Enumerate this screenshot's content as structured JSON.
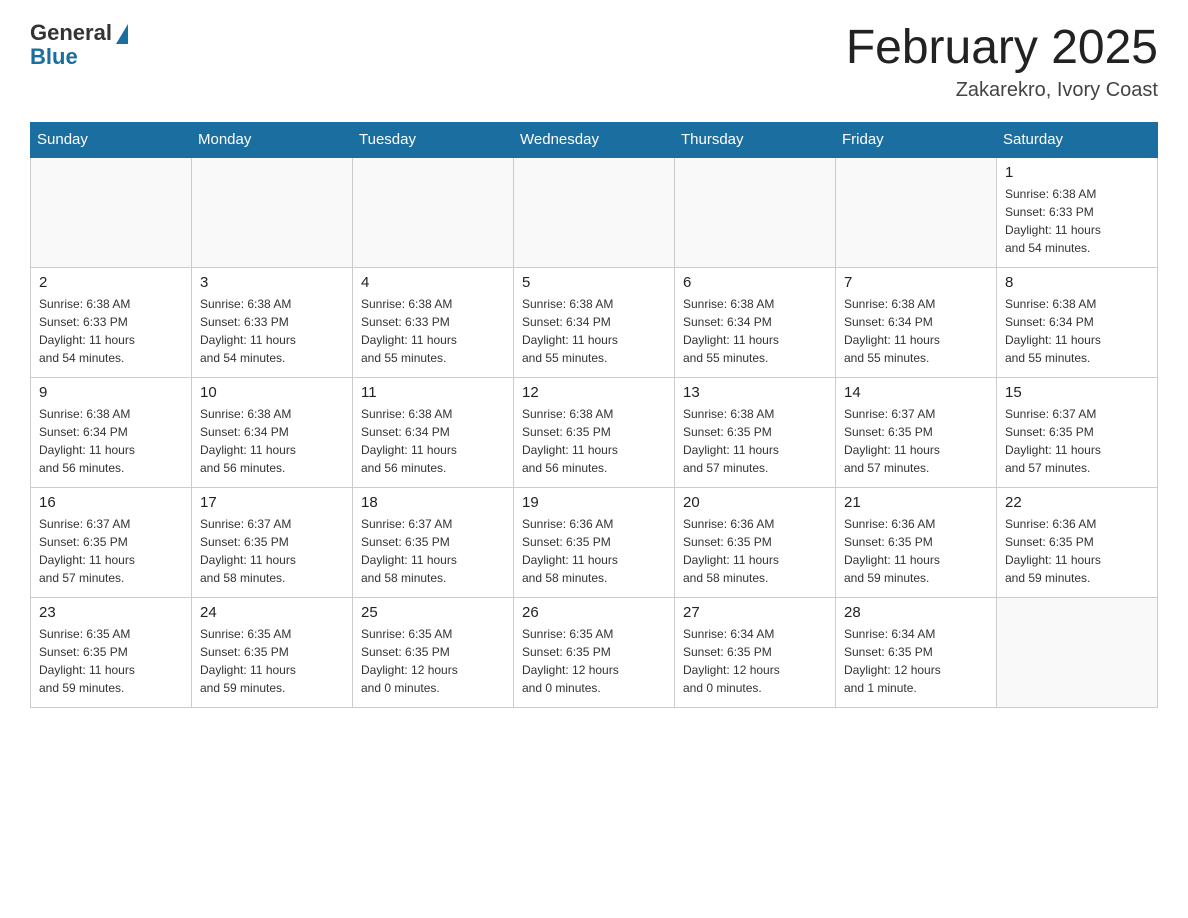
{
  "header": {
    "logo_general": "General",
    "logo_blue": "Blue",
    "month_title": "February 2025",
    "location": "Zakarekro, Ivory Coast"
  },
  "days_of_week": [
    "Sunday",
    "Monday",
    "Tuesday",
    "Wednesday",
    "Thursday",
    "Friday",
    "Saturday"
  ],
  "weeks": [
    [
      {
        "day": "",
        "info": ""
      },
      {
        "day": "",
        "info": ""
      },
      {
        "day": "",
        "info": ""
      },
      {
        "day": "",
        "info": ""
      },
      {
        "day": "",
        "info": ""
      },
      {
        "day": "",
        "info": ""
      },
      {
        "day": "1",
        "info": "Sunrise: 6:38 AM\nSunset: 6:33 PM\nDaylight: 11 hours\nand 54 minutes."
      }
    ],
    [
      {
        "day": "2",
        "info": "Sunrise: 6:38 AM\nSunset: 6:33 PM\nDaylight: 11 hours\nand 54 minutes."
      },
      {
        "day": "3",
        "info": "Sunrise: 6:38 AM\nSunset: 6:33 PM\nDaylight: 11 hours\nand 54 minutes."
      },
      {
        "day": "4",
        "info": "Sunrise: 6:38 AM\nSunset: 6:33 PM\nDaylight: 11 hours\nand 55 minutes."
      },
      {
        "day": "5",
        "info": "Sunrise: 6:38 AM\nSunset: 6:34 PM\nDaylight: 11 hours\nand 55 minutes."
      },
      {
        "day": "6",
        "info": "Sunrise: 6:38 AM\nSunset: 6:34 PM\nDaylight: 11 hours\nand 55 minutes."
      },
      {
        "day": "7",
        "info": "Sunrise: 6:38 AM\nSunset: 6:34 PM\nDaylight: 11 hours\nand 55 minutes."
      },
      {
        "day": "8",
        "info": "Sunrise: 6:38 AM\nSunset: 6:34 PM\nDaylight: 11 hours\nand 55 minutes."
      }
    ],
    [
      {
        "day": "9",
        "info": "Sunrise: 6:38 AM\nSunset: 6:34 PM\nDaylight: 11 hours\nand 56 minutes."
      },
      {
        "day": "10",
        "info": "Sunrise: 6:38 AM\nSunset: 6:34 PM\nDaylight: 11 hours\nand 56 minutes."
      },
      {
        "day": "11",
        "info": "Sunrise: 6:38 AM\nSunset: 6:34 PM\nDaylight: 11 hours\nand 56 minutes."
      },
      {
        "day": "12",
        "info": "Sunrise: 6:38 AM\nSunset: 6:35 PM\nDaylight: 11 hours\nand 56 minutes."
      },
      {
        "day": "13",
        "info": "Sunrise: 6:38 AM\nSunset: 6:35 PM\nDaylight: 11 hours\nand 57 minutes."
      },
      {
        "day": "14",
        "info": "Sunrise: 6:37 AM\nSunset: 6:35 PM\nDaylight: 11 hours\nand 57 minutes."
      },
      {
        "day": "15",
        "info": "Sunrise: 6:37 AM\nSunset: 6:35 PM\nDaylight: 11 hours\nand 57 minutes."
      }
    ],
    [
      {
        "day": "16",
        "info": "Sunrise: 6:37 AM\nSunset: 6:35 PM\nDaylight: 11 hours\nand 57 minutes."
      },
      {
        "day": "17",
        "info": "Sunrise: 6:37 AM\nSunset: 6:35 PM\nDaylight: 11 hours\nand 58 minutes."
      },
      {
        "day": "18",
        "info": "Sunrise: 6:37 AM\nSunset: 6:35 PM\nDaylight: 11 hours\nand 58 minutes."
      },
      {
        "day": "19",
        "info": "Sunrise: 6:36 AM\nSunset: 6:35 PM\nDaylight: 11 hours\nand 58 minutes."
      },
      {
        "day": "20",
        "info": "Sunrise: 6:36 AM\nSunset: 6:35 PM\nDaylight: 11 hours\nand 58 minutes."
      },
      {
        "day": "21",
        "info": "Sunrise: 6:36 AM\nSunset: 6:35 PM\nDaylight: 11 hours\nand 59 minutes."
      },
      {
        "day": "22",
        "info": "Sunrise: 6:36 AM\nSunset: 6:35 PM\nDaylight: 11 hours\nand 59 minutes."
      }
    ],
    [
      {
        "day": "23",
        "info": "Sunrise: 6:35 AM\nSunset: 6:35 PM\nDaylight: 11 hours\nand 59 minutes."
      },
      {
        "day": "24",
        "info": "Sunrise: 6:35 AM\nSunset: 6:35 PM\nDaylight: 11 hours\nand 59 minutes."
      },
      {
        "day": "25",
        "info": "Sunrise: 6:35 AM\nSunset: 6:35 PM\nDaylight: 12 hours\nand 0 minutes."
      },
      {
        "day": "26",
        "info": "Sunrise: 6:35 AM\nSunset: 6:35 PM\nDaylight: 12 hours\nand 0 minutes."
      },
      {
        "day": "27",
        "info": "Sunrise: 6:34 AM\nSunset: 6:35 PM\nDaylight: 12 hours\nand 0 minutes."
      },
      {
        "day": "28",
        "info": "Sunrise: 6:34 AM\nSunset: 6:35 PM\nDaylight: 12 hours\nand 1 minute."
      },
      {
        "day": "",
        "info": ""
      }
    ]
  ]
}
